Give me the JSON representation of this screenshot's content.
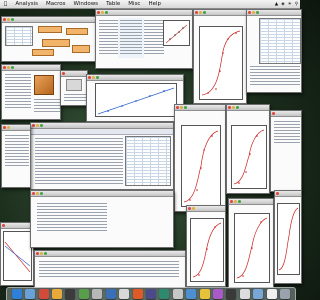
{
  "menubar": {
    "items": [
      "Analysis",
      "Macros",
      "Windows",
      "Table",
      "Misc",
      "Help"
    ]
  },
  "dock": {
    "icons": [
      {
        "name": "finder-icon",
        "color": "#2f7fd6"
      },
      {
        "name": "app-icon",
        "color": "#6aa0d8"
      },
      {
        "name": "app-icon",
        "color": "#d24a3a"
      },
      {
        "name": "app-icon",
        "color": "#e8a93b"
      },
      {
        "name": "app-icon",
        "color": "#3c3c3c"
      },
      {
        "name": "app-icon",
        "color": "#5a9e4b"
      },
      {
        "name": "app-icon",
        "color": "#b8b8b8"
      },
      {
        "name": "app-icon",
        "color": "#3b6fb8"
      },
      {
        "name": "app-icon",
        "color": "#d8d8d8"
      },
      {
        "name": "app-icon",
        "color": "#e05a28"
      },
      {
        "name": "app-icon",
        "color": "#4b4b8a"
      },
      {
        "name": "app-icon",
        "color": "#2e8a6e"
      },
      {
        "name": "app-icon",
        "color": "#c7c7c7"
      },
      {
        "name": "app-icon",
        "color": "#4d8fd1"
      },
      {
        "name": "app-icon",
        "color": "#e6c23a"
      },
      {
        "name": "app-icon",
        "color": "#a85ac8"
      },
      {
        "name": "app-icon",
        "color": "#3a3a3a"
      },
      {
        "name": "app-icon",
        "color": "#dcdcdc"
      },
      {
        "name": "app-icon",
        "color": "#7aa6d6"
      },
      {
        "name": "app-icon",
        "color": "#f0f0f0"
      },
      {
        "name": "trash-icon",
        "color": "#9aa3ad"
      }
    ]
  }
}
